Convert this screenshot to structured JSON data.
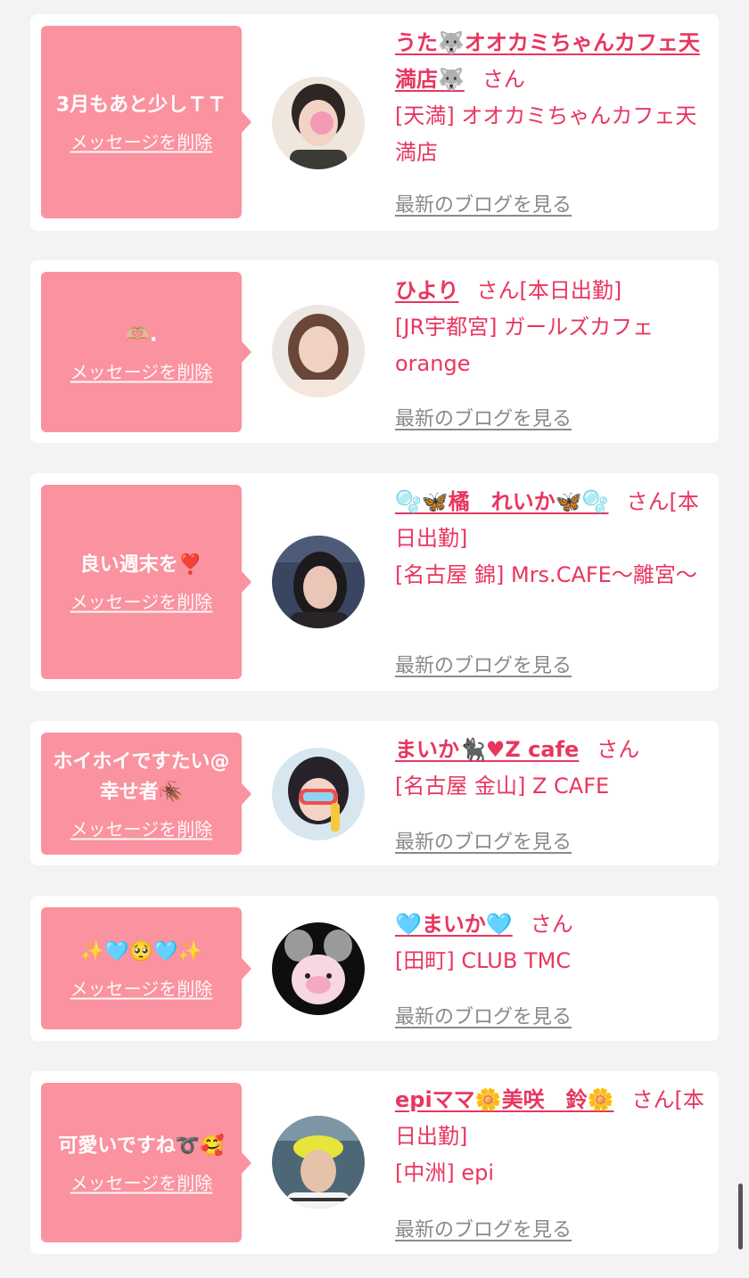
{
  "cards": [
    {
      "message": "3月もあと少しＴＴ",
      "delete_label": "メッセージを削除",
      "name": "うた🐺オオカミちゃんカフェ天満店🐺",
      "san": "さん",
      "status": "",
      "shop": "[天満] オオカミちゃんカフェ天満店",
      "blog_label": "最新のブログを見る",
      "avatar_colors": [
        "#efe6dd",
        "#2d2622",
        "#f2d3c4"
      ]
    },
    {
      "message": "🫶🏼.",
      "delete_label": "メッセージを削除",
      "name": "ひより",
      "san": "さん",
      "status": "[本日出勤]",
      "shop": "[JR宇都宮] ガールズカフェorange",
      "blog_label": "最新のブログを見る",
      "avatar_colors": [
        "#ece7e2",
        "#6a4638",
        "#f0d2c3"
      ]
    },
    {
      "message": "良い週末を❣️",
      "delete_label": "メッセージを削除",
      "name": "🫧🦋橘　れいか🦋🫧",
      "san": "さん",
      "status": "[本日出勤]",
      "shop": "[名古屋 錦] Mrs.CAFE～離宮～",
      "blog_label": "最新のブログを見る",
      "avatar_colors": [
        "#3a4660",
        "#1d1a1d",
        "#e9c6b6"
      ]
    },
    {
      "message": "ホイホイですたい@幸せ者🪳",
      "delete_label": "メッセージを削除",
      "name": "まいか🐈‍⬛♥Z cafe",
      "san": "さん",
      "status": "",
      "shop": "[名古屋 金山] Z CAFE",
      "blog_label": "最新のブログを見る",
      "avatar_colors": [
        "#d7e6ef",
        "#27222a",
        "#ef4e4e"
      ]
    },
    {
      "message": "✨🩵🥺🩵✨",
      "delete_label": "メッセージを削除",
      "name": "🩵まいか🩵",
      "san": "さん",
      "status": "",
      "shop": "[田町] CLUB TMC",
      "blog_label": "最新のブログを見る",
      "avatar_colors": [
        "#0e0e0e",
        "#f7d7e4",
        "#f4a9c3"
      ]
    },
    {
      "message": "可愛いですね➰🥰",
      "delete_label": "メッセージを削除",
      "name": "epiママ🌼美咲　鈴🌼",
      "san": "さん",
      "status": "[本日出勤]",
      "shop": "[中洲] epi",
      "blog_label": "最新のブログを見る",
      "avatar_colors": [
        "#4d6777",
        "#e8e53a",
        "#e6c2ab"
      ]
    }
  ]
}
